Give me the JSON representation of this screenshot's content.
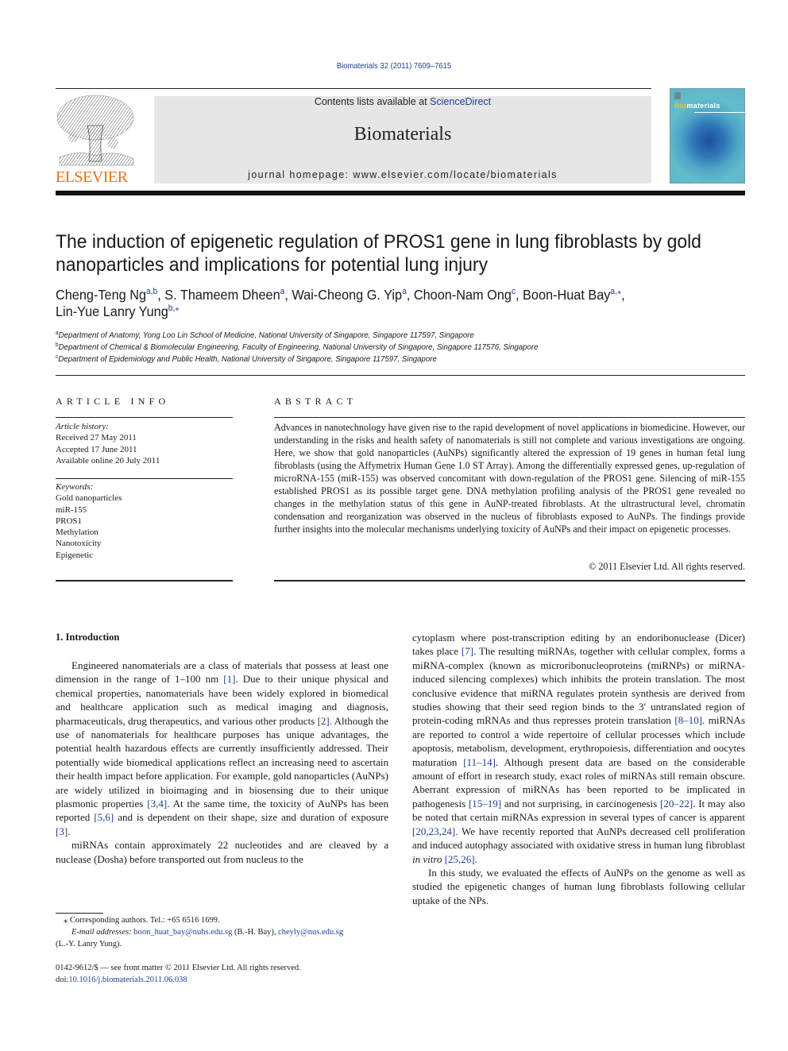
{
  "header": {
    "citation": "Biomaterials 32 (2011) 7609–7615",
    "contents_prefix": "Contents lists available at ",
    "contents_link": "ScienceDirect",
    "journal_name": "Biomaterials",
    "homepage_prefix": "journal homepage: ",
    "homepage_url": "www.elsevier.com/locate/biomaterials",
    "publisher_logo_text": "ELSEVIER",
    "cover_title_highlight": "Bio",
    "cover_title_rest": "materials"
  },
  "article": {
    "title_line1": "The induction of epigenetic regulation of PROS1 gene in lung fibroblasts by gold",
    "title_line2": "nanoparticles and implications for potential lung injury",
    "authors": [
      {
        "name": "Cheng-Teng Ng",
        "sup": "a,b",
        "sep": ", "
      },
      {
        "name": "S. Thameem Dheen",
        "sup": "a",
        "sep": ", "
      },
      {
        "name": "Wai-Cheong G. Yip",
        "sup": "a",
        "sep": ", "
      },
      {
        "name": "Choon-Nam Ong",
        "sup": "c",
        "sep": ", "
      },
      {
        "name": "Boon-Huat Bay",
        "sup": "a,⁎",
        "sep": ","
      },
      {
        "name": "Lin-Yue Lanry Yung",
        "sup": "b,⁎",
        "sep": ""
      }
    ],
    "affiliations": [
      {
        "key": "a",
        "text": "Department of Anatomy, Yong Loo Lin School of Medicine, National University of Singapore, Singapore 117597, Singapore"
      },
      {
        "key": "b",
        "text": "Department of Chemical & Biomolecular Engineering, Faculty of Engineering, National University of Singapore, Singapore 117576, Singapore"
      },
      {
        "key": "c",
        "text": "Department of Epidemiology and Public Health, National University of Singapore, Singapore 117597, Singapore"
      }
    ]
  },
  "article_info": {
    "heading": "ARTICLE INFO",
    "history_label": "Article history:",
    "received": "Received 27 May 2011",
    "accepted": "Accepted 17 June 2011",
    "online": "Available online 20 July 2011",
    "keywords_label": "Keywords:",
    "keywords": [
      "Gold nanoparticles",
      "miR-155",
      "PROS1",
      "Methylation",
      "Nanotoxicity",
      "Epigenetic"
    ]
  },
  "abstract": {
    "heading": "ABSTRACT",
    "text": "Advances in nanotechnology have given rise to the rapid development of novel applications in biomedicine. However, our understanding in the risks and health safety of nanomaterials is still not complete and various investigations are ongoing. Here, we show that gold nanoparticles (AuNPs) significantly altered the expression of 19 genes in human fetal lung fibroblasts (using the Affymetrix Human Gene 1.0 ST Array). Among the differentially expressed genes, up-regulation of microRNA-155 (miR-155) was observed concomitant with down-regulation of the PROS1 gene. Silencing of miR-155 established PROS1 as its possible target gene. DNA methylation profiling analysis of the PROS1 gene revealed no changes in the methylation status of this gene in AuNP-treated fibroblasts. At the ultra­structural level, chromatin condensation and reorganization was observed in the nucleus of fibroblasts exposed to AuNPs. The findings provide further insights into the molecular mechanisms underlying toxicity of AuNPs and their impact on epigenetic processes.",
    "copyright": "© 2011 Elsevier Ltd. All rights reserved."
  },
  "introduction": {
    "heading": "1.  Introduction",
    "left_col": {
      "p1": [
        {
          "t": "Engineered nanomaterials are a class of materials that possess at least one dimension in the range of 1–100 nm "
        },
        {
          "r": "[1]"
        },
        {
          "t": ". Due to their unique physical and chemical properties, nanomaterials have been widely explored in biomedical and healthcare application such as medical imaging and diagnosis, pharmaceuticals, drug therapeu­tics, and various other products "
        },
        {
          "r": "[2]"
        },
        {
          "t": ". Although the use of nano­materials for healthcare purposes has unique advantages, the potential health hazardous effects are currently insufficiently addressed. Their potentially wide biomedical applications reflect an increasing need to ascertain their health impact before application. For example, gold nanoparticles (AuNPs) are widely utilized in bioimaging and in biosensing due to their unique plasmonic properties "
        },
        {
          "r": "[3,4]"
        },
        {
          "t": ". At the same time, the toxicity of AuNPs has been reported "
        },
        {
          "r": "[5,6]"
        },
        {
          "t": " and is dependent on their shape, size and duration of exposure "
        },
        {
          "r": "[3]"
        },
        {
          "t": "."
        }
      ],
      "p2": [
        {
          "t": "miRNAs contain approximately 22 nucleotides and are cleaved by a nuclease (Dosha) before transported out from nucleus to the"
        }
      ]
    },
    "right_col": {
      "p1": [
        {
          "t": "cytoplasm where post-transcription editing by an endor­ibonuclease (Dicer) takes place "
        },
        {
          "r": "[7]"
        },
        {
          "t": ". The resulting miRNAs, together with cellular complex, forms a miRNA-complex (known as micro­ribonucleoproteins (miRNPs) or miRNA-induced silencing complexes) which inhibits the protein translation. The most conclusive evidence that miRNA regulates protein synthesis are derived from studies showing that their seed region binds to the 3′ untranslated region of protein-coding mRNAs and thus represses protein translation "
        },
        {
          "r": "[8–10]"
        },
        {
          "t": ". miRNAs are reported to control a wide repertoire of cellular processes which include apoptosis, metabo­lism, development, erythropoiesis, differentiation and oocytes maturation "
        },
        {
          "r": "[11–14]"
        },
        {
          "t": ". Although present data are based on the considerable amount of effort in research study, exact roles of miRNAs still remain obscure. Aberrant expression of miRNAs has been reported to be implicated in pathogenesis "
        },
        {
          "r": "[15–19]"
        },
        {
          "t": " and not surprising, in carcinogenesis "
        },
        {
          "r": "[20–22]"
        },
        {
          "t": ". It may also be noted that certain miRNAs expression in several types of cancer is apparent "
        },
        {
          "r": "[20,23,24]"
        },
        {
          "t": ". We have recently reported that AuNPs decreased cell proliferation and induced autophagy associated with oxidative stress in human lung fibroblast "
        },
        {
          "i": "in vitro"
        },
        {
          "t": " "
        },
        {
          "r": "[25,26]"
        },
        {
          "t": "."
        }
      ],
      "p2": [
        {
          "t": "In this study, we evaluated the effects of AuNPs on the genome as well as studied the epigenetic changes of human lung fibroblasts following cellular uptake of the NPs."
        }
      ]
    }
  },
  "footnotes": {
    "corresponding": "⁎ Corresponding authors. Tel.: +65 6516 1699.",
    "email_label": "E-mail addresses:",
    "email1": "boon_huat_bay@nuhs.edu.sg",
    "email1_owner": " (B.-H. Bay), ",
    "email2": "cheyly@nus.edu.sg",
    "email2_owner": "(L.-Y. Lanry Yung).",
    "issn_line": "0142-9612/$ — see front matter © 2011 Elsevier Ltd. All rights reserved.",
    "doi_prefix": "doi:",
    "doi": "10.1016/j.biomaterials.2011.06.038"
  },
  "colors": {
    "link": "#1f3f8f",
    "elsevier_orange": "#e8701a",
    "masthead_gray": "#e6e6e6"
  }
}
